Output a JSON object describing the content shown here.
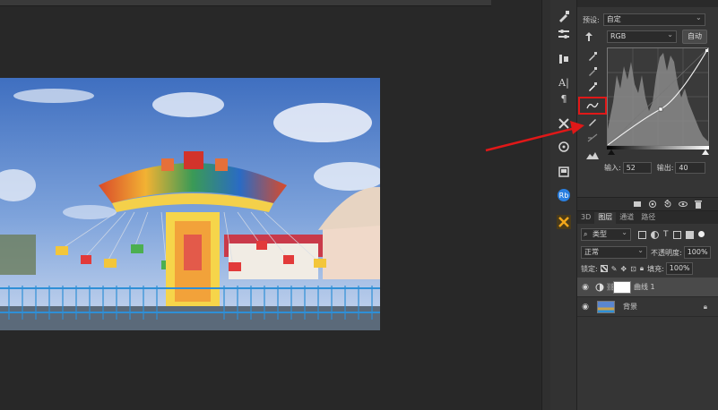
{
  "panel": {
    "preset_label": "预设:",
    "preset_value": "自定",
    "channel_value": "RGB",
    "auto_label": "自动",
    "input_label": "输入:",
    "input_value": "52",
    "output_label": "输出:",
    "output_value": "40"
  },
  "layers_panel": {
    "tabs": [
      {
        "label": "3D"
      },
      {
        "label": "图层"
      },
      {
        "label": "通道"
      },
      {
        "label": "路径"
      }
    ],
    "filter_kind": "类型",
    "blend_mode": "正常",
    "opacity_label": "不透明度:",
    "opacity_value": "100%",
    "lock_label": "锁定:",
    "fill_label": "填充:",
    "fill_value": "100%",
    "layers": [
      {
        "name": "曲线 1"
      },
      {
        "name": "背景"
      }
    ]
  },
  "colors": {
    "highlight": "#e01818",
    "background": "#282828",
    "panel": "#353535"
  }
}
